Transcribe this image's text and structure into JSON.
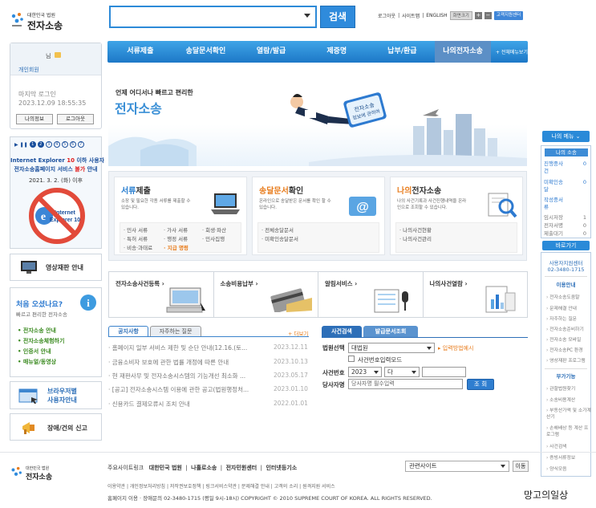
{
  "logo": {
    "small": "대한민국 법원",
    "big": "전자소송"
  },
  "search": {
    "value": "",
    "button": "검색"
  },
  "util": {
    "logout": "로그아웃",
    "sitemap": "사이트맵",
    "english": "ENGLISH",
    "zoom": "화면크기",
    "plus": "+",
    "minus": "−",
    "remote": "고객지원센터"
  },
  "nav": {
    "items": [
      "서류제출",
      "송달문서확인",
      "열람/발급",
      "제증명",
      "납부/환급",
      "나의전자소송"
    ],
    "active_index": 5,
    "all_menu": "+ 전체메뉴보기"
  },
  "login": {
    "user_suffix": "님",
    "grade": "개인회원",
    "last_login_label": "마지막 로그인",
    "last_login_time": "2023.12.09 18:55:35",
    "myinfo": "나의정보",
    "logout": "로그아웃"
  },
  "ie_banner": {
    "pages": [
      "1",
      "2",
      "3",
      "4",
      "5",
      "6",
      "7"
    ],
    "line1_a": "Internet Explorer ",
    "line1_b": "10",
    "line1_c": " 이하 사용자",
    "line2_a": "전자소송홈페이지 서비스 ",
    "line2_b": "불가",
    "line2_c": " 안내",
    "line3": "2021. 3. 2. (화) 이후",
    "logo_text": "Internet Explorer 10"
  },
  "video": {
    "label": "영상재판 안내"
  },
  "welcome": {
    "title": "처음 오셨나요?",
    "sub": "빠르고 편리한 전자소송",
    "items": [
      "전자소송 안내",
      "전자소송체험하기",
      "인증서 안내",
      "매뉴얼/동영상"
    ]
  },
  "browser": {
    "line1": "브라우저별",
    "line2": "사용자안내"
  },
  "report": {
    "label": "장애/건의 신고"
  },
  "hero": {
    "sub": "언제 어디서나 빠르고 편리한",
    "title": "전자소송",
    "bubble": "전자소송\n정보에 관하여"
  },
  "services": [
    {
      "t1": "서류",
      "t2": "제출",
      "desc": "소장 및 필요한 각종 서류를 제출할 수 있습니다.",
      "links": [
        [
          "민사 서류",
          "가사 서류",
          "회생·파산"
        ],
        [
          "특허 서류",
          "행정 서류",
          "민사집행"
        ],
        [
          "비송·과태료",
          "지급 명령",
          ""
        ]
      ]
    },
    {
      "t1": "송달문서",
      "t2": "확인",
      "desc": "온라인으로 송달받은 문서를 확인 할 수 있습니다.",
      "links": [
        [
          "전체송달문서"
        ],
        [
          "미확인송달문서"
        ]
      ]
    },
    {
      "t1": "나의",
      "t2": "전자소송",
      "desc": "나의 사건기록과 사건진행내역을 온라인으로 조회할 수 있습니다.",
      "links": [
        [
          "나의사건현황"
        ],
        [
          "나의사건관리"
        ]
      ]
    }
  ],
  "quick": [
    "전자소송사건등록 ›",
    "소송비용납부 ›",
    "알림서비스 ›",
    "나의사건열람 ›"
  ],
  "notices": {
    "tabs": [
      "공지사항",
      "자주하는 질문"
    ],
    "more": "+ 더보기",
    "rows": [
      {
        "title": "· 홈페이지 일부 서비스 제한 및 순단 안내(12.16.(토...",
        "date": "2023.12.11"
      },
      {
        "title": "· 금융소비자 보호에 관한 법률 개정에 따른 안내",
        "date": "2023.10.13"
      },
      {
        "title": "· 현 재판사무 및 전자소송시스템의 기능개선 최소화 ...",
        "date": "2023.05.17"
      },
      {
        "title": "· [공고] 전자소송시스템 이용에 관한 공고(법원행정처...",
        "date": "2023.01.10"
      },
      {
        "title": "· 신용카드 결제오류시 조치 안내",
        "date": "2022.01.01"
      }
    ]
  },
  "case_search": {
    "tabs": [
      "사건검색",
      "발급문서조회"
    ],
    "court_label": "법원선택",
    "court_value": "대법원",
    "input_method": "입력방법예시",
    "related_checkbox": "사건번호입력모드",
    "case_no_label": "사건번호",
    "year": "2023",
    "type": "다",
    "party_label": "당사자명",
    "party_placeholder": "당사자명 필수입력",
    "query": "조 회"
  },
  "my_menu": {
    "button": "나의 메뉴",
    "head": "나의 소송",
    "rows": [
      {
        "label": "진행중사건",
        "count": "0",
        "grey": false
      },
      {
        "label": "미확인송달",
        "count": "0",
        "grey": false
      },
      {
        "label": "작성중서류",
        "count": "",
        "grey": false
      },
      {
        "label": "임시저장",
        "count": "1",
        "grey": true
      },
      {
        "label": "전자서명",
        "count": "0",
        "grey": true
      },
      {
        "label": "제출대기",
        "count": "0",
        "grey": true
      }
    ]
  },
  "goto": {
    "button": "바로가기",
    "center": "사용자지원센터",
    "phone": "02-3480-1715",
    "sec1": "이용안내",
    "links1": [
      "전자소송도움말",
      "문제해결 안내",
      "자주하는 질문",
      "전자소송준비하기",
      "전자소송 모바일",
      "전자소송PC 환경",
      "영상재판 프로그램"
    ],
    "sec2": "부가기능",
    "links2": [
      "관할법원찾기",
      "소송비용계산",
      "부동산가액 및 소가계산기",
      "손해배상 등 계산 프로그램",
      "사건검색",
      "증빙서류정보",
      "양식모음"
    ]
  },
  "footer": {
    "links": [
      "주요사이트링크",
      "대한민국 법원",
      "나홀로소송",
      "전자민원센터",
      "인터넷등기소"
    ],
    "related": "관련사이트",
    "move": "이동",
    "line1": "이용약관 | 개인정보처리방침 | 저작권보호정책 | 링크서비스약관 | 문제해결 안내 | 고객의 소리 | 원격지원 서비스",
    "line2": "홈페이지 이용 · 장애문의 02-3480-1715 (평일 9시-18시)   COPYRIGHT © 2010 SUPREME COURT OF KOREA. ALL RIGHTS RESERVED."
  },
  "watermark": "망고의일상",
  "colors": {
    "primary": "#2f8bdc",
    "nav": "#1d78c7",
    "accent_orange": "#e87d1e",
    "red": "#e02020"
  }
}
